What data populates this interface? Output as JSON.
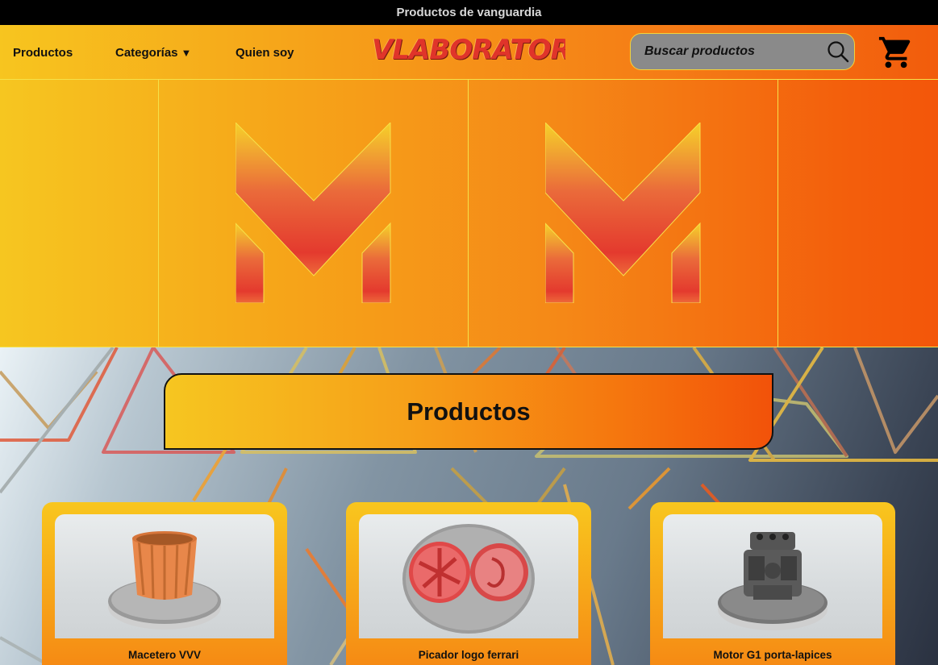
{
  "topbar": {
    "text": "Productos de vanguardia"
  },
  "nav": {
    "productos": "Productos",
    "categorias": "Categorías",
    "quien_soy": "Quien soy",
    "caret": "▼"
  },
  "brand": {
    "logo_text": "VLABORATORI"
  },
  "search": {
    "placeholder": "Buscar productos",
    "icon": "search-icon"
  },
  "cart": {
    "icon": "cart-icon"
  },
  "hero": {
    "panels": [
      "m-logo",
      "m-logo"
    ]
  },
  "section": {
    "title": "Productos"
  },
  "products": [
    {
      "name": "Macetero VVV"
    },
    {
      "name": "Picador logo ferrari"
    },
    {
      "name": "Motor G1 porta-lapices"
    }
  ],
  "colors": {
    "accent_yellow": "#f6c620",
    "accent_orange": "#f57d16",
    "accent_red": "#f2520a",
    "logo_red": "#e0342a"
  }
}
